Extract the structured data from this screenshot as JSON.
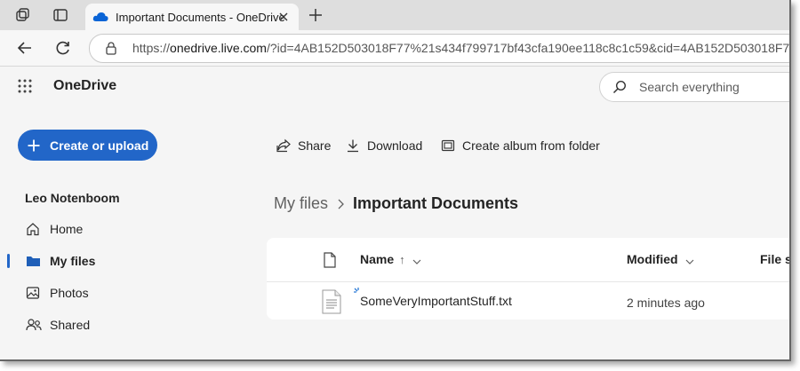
{
  "browser": {
    "tab": {
      "title": "Important Documents - OneDrive"
    },
    "address": {
      "url_prefix": "https://",
      "url_host": "onedrive.live.com",
      "url_rest": "/?id=4AB152D503018F77%21s434f799717bf43cfa190ee118c8c1c59&cid=4AB152D503018F77"
    }
  },
  "app": {
    "name": "OneDrive",
    "search": {
      "placeholder": "Search everything"
    }
  },
  "sidebar": {
    "create_label": "Create or upload",
    "user_name": "Leo Notenboom",
    "items": [
      {
        "label": "Home",
        "icon": "home-icon"
      },
      {
        "label": "My files",
        "icon": "folder-icon",
        "active": true
      },
      {
        "label": "Photos",
        "icon": "photo-icon"
      },
      {
        "label": "Shared",
        "icon": "people-icon"
      }
    ]
  },
  "commands": [
    {
      "label": "Share",
      "icon": "share-icon"
    },
    {
      "label": "Download",
      "icon": "download-icon"
    },
    {
      "label": "Create album from folder",
      "icon": "album-icon"
    }
  ],
  "breadcrumb": {
    "root": "My files",
    "current": "Important Documents"
  },
  "file_list": {
    "columns": {
      "name": "Name",
      "sort_arrow": "↑",
      "modified": "Modified",
      "size": "File s"
    },
    "rows": [
      {
        "name": "SomeVeryImportantStuff.txt",
        "modified": "2 minutes ago"
      }
    ]
  },
  "colors": {
    "accent": "#2266c8",
    "tab_strip": "#dedede",
    "page_bg": "#f5f5f5"
  }
}
